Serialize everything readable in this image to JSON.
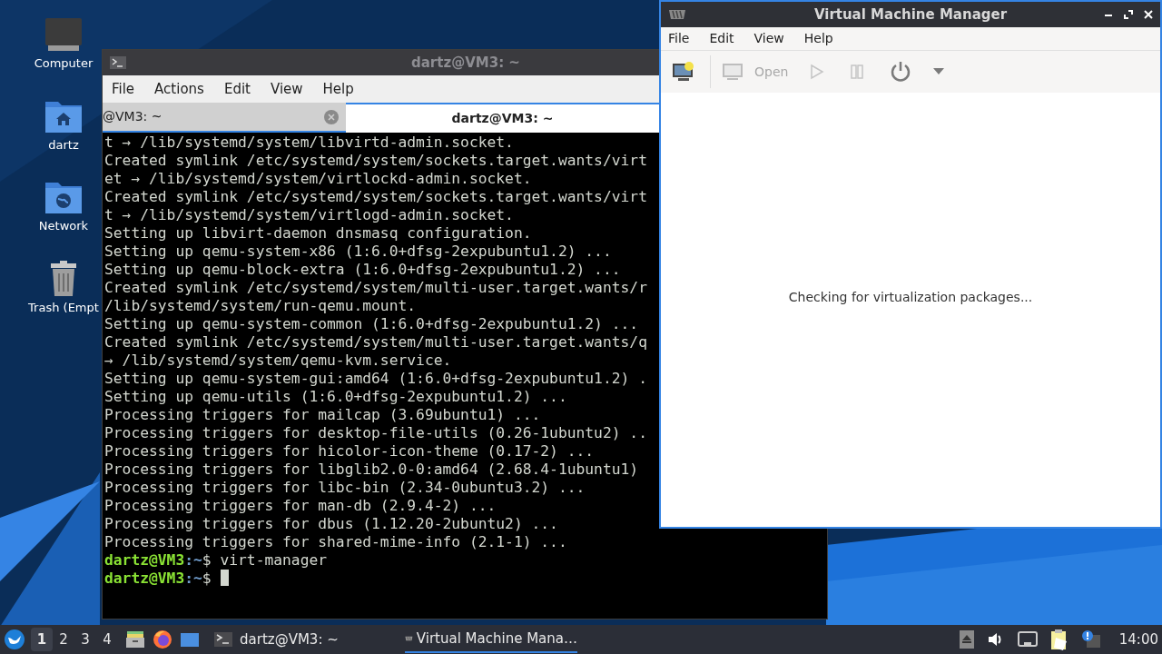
{
  "desktop_icons": [
    {
      "label": "Computer",
      "kind": "computer"
    },
    {
      "label": "dartz",
      "kind": "home"
    },
    {
      "label": "Network",
      "kind": "network"
    },
    {
      "label": "Trash (Empt",
      "kind": "trash"
    }
  ],
  "terminal": {
    "title": "dartz@VM3: ~",
    "menu": [
      "File",
      "Actions",
      "Edit",
      "View",
      "Help"
    ],
    "tabs": [
      {
        "label": "@VM3: ~",
        "selected": false,
        "closable": true
      },
      {
        "label": "dartz@VM3: ~",
        "selected": true,
        "closable": false
      }
    ],
    "lines": [
      {
        "kind": "text",
        "text": "t → /lib/systemd/system/libvirtd-admin.socket."
      },
      {
        "kind": "text",
        "text": "Created symlink /etc/systemd/system/sockets.target.wants/virt"
      },
      {
        "kind": "text",
        "text": "et → /lib/systemd/system/virtlockd-admin.socket."
      },
      {
        "kind": "text",
        "text": "Created symlink /etc/systemd/system/sockets.target.wants/virt"
      },
      {
        "kind": "text",
        "text": "t → /lib/systemd/system/virtlogd-admin.socket."
      },
      {
        "kind": "text",
        "text": "Setting up libvirt-daemon dnsmasq configuration."
      },
      {
        "kind": "text",
        "text": "Setting up qemu-system-x86 (1:6.0+dfsg-2expubuntu1.2) ..."
      },
      {
        "kind": "text",
        "text": "Setting up qemu-block-extra (1:6.0+dfsg-2expubuntu1.2) ..."
      },
      {
        "kind": "text",
        "text": "Created symlink /etc/systemd/system/multi-user.target.wants/r"
      },
      {
        "kind": "text",
        "text": "/lib/systemd/system/run-qemu.mount."
      },
      {
        "kind": "text",
        "text": "Setting up qemu-system-common (1:6.0+dfsg-2expubuntu1.2) ..."
      },
      {
        "kind": "text",
        "text": "Created symlink /etc/systemd/system/multi-user.target.wants/q"
      },
      {
        "kind": "text",
        "text": "→ /lib/systemd/system/qemu-kvm.service."
      },
      {
        "kind": "text",
        "text": "Setting up qemu-system-gui:amd64 (1:6.0+dfsg-2expubuntu1.2) ."
      },
      {
        "kind": "text",
        "text": "Setting up qemu-utils (1:6.0+dfsg-2expubuntu1.2) ..."
      },
      {
        "kind": "text",
        "text": "Processing triggers for mailcap (3.69ubuntu1) ..."
      },
      {
        "kind": "text",
        "text": "Processing triggers for desktop-file-utils (0.26-1ubuntu2) .."
      },
      {
        "kind": "text",
        "text": "Processing triggers for hicolor-icon-theme (0.17-2) ..."
      },
      {
        "kind": "text",
        "text": "Processing triggers for libglib2.0-0:amd64 (2.68.4-1ubuntu1)"
      },
      {
        "kind": "text",
        "text": "Processing triggers for libc-bin (2.34-0ubuntu3.2) ..."
      },
      {
        "kind": "text",
        "text": "Processing triggers for man-db (2.9.4-2) ..."
      },
      {
        "kind": "text",
        "text": "Processing triggers for dbus (1.12.20-2ubuntu2) ..."
      },
      {
        "kind": "text",
        "text": "Processing triggers for shared-mime-info (2.1-1) ..."
      },
      {
        "kind": "prompt",
        "user": "dartz@VM3",
        "path": ":~",
        "command": "$ virt-manager",
        "cursor": false
      },
      {
        "kind": "prompt",
        "user": "dartz@VM3",
        "path": ":~",
        "command": "$",
        "cursor": true
      }
    ]
  },
  "vmm": {
    "title": "Virtual Machine Manager",
    "menu": [
      "File",
      "Edit",
      "View",
      "Help"
    ],
    "toolbar": [
      {
        "kind": "new",
        "disabled": false
      },
      {
        "kind": "open",
        "label": "Open",
        "disabled": true
      },
      {
        "kind": "play",
        "disabled": true
      },
      {
        "kind": "pause",
        "disabled": true
      },
      {
        "kind": "power",
        "disabled": false
      },
      {
        "kind": "caret",
        "disabled": false
      }
    ],
    "message": "Checking for virtualization packages..."
  },
  "taskbar": {
    "workspaces": [
      {
        "label": "1",
        "selected": true
      },
      {
        "label": "2",
        "selected": false
      },
      {
        "label": "3",
        "selected": false
      },
      {
        "label": "4",
        "selected": false
      }
    ],
    "tasks": [
      {
        "kind": "terminal",
        "label": "dartz@VM3: ~",
        "selected": false
      },
      {
        "kind": "vmm",
        "label": "Virtual Machine Mana…",
        "selected": true
      }
    ],
    "clock": "14:00"
  }
}
